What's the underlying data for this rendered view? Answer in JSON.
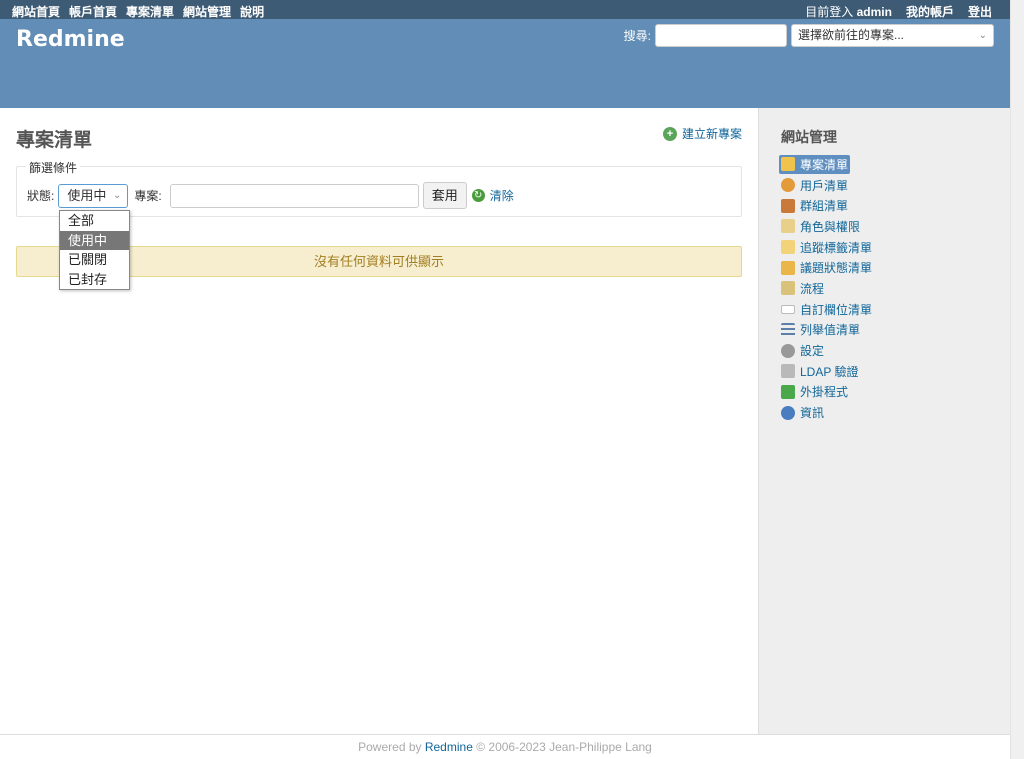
{
  "top_menu": {
    "left_items": [
      "網站首頁",
      "帳戶首頁",
      "專案清單",
      "網站管理",
      "說明"
    ],
    "logged_as_prefix": "目前登入",
    "logged_as_user": "admin",
    "my_account": "我的帳戶",
    "logout": "登出"
  },
  "header": {
    "title": "Redmine",
    "search_label": "搜尋:",
    "search_value": "",
    "project_jump_placeholder": "選擇欲前往的專案..."
  },
  "content": {
    "title": "專案清單",
    "new_project_link": "建立新專案",
    "filters_legend": "篩選條件",
    "status_label": "狀態:",
    "status_selected": "使用中",
    "project_label": "專案:",
    "project_value": "",
    "apply_button": "套用",
    "clear_link": "清除",
    "nodata_message": "沒有任何資料可供顯示"
  },
  "status_dropdown": {
    "options": [
      "全部",
      "使用中",
      "已關閉",
      "已封存"
    ],
    "selected_index": 1
  },
  "sidebar": {
    "title": "網站管理",
    "items": [
      {
        "label": "專案清單",
        "icon": "projects-icon",
        "selected": true
      },
      {
        "label": "用戶清單",
        "icon": "user-icon",
        "selected": false
      },
      {
        "label": "群組清單",
        "icon": "group-icon",
        "selected": false
      },
      {
        "label": "角色與權限",
        "icon": "roles-icon",
        "selected": false
      },
      {
        "label": "追蹤標籤清單",
        "icon": "trackers-icon",
        "selected": false
      },
      {
        "label": "議題狀態清單",
        "icon": "issue-status-icon",
        "selected": false
      },
      {
        "label": "流程",
        "icon": "workflow-icon",
        "selected": false
      },
      {
        "label": "自訂欄位清單",
        "icon": "custom-fields-icon",
        "selected": false
      },
      {
        "label": "列舉值清單",
        "icon": "enumerations-icon",
        "selected": false
      },
      {
        "label": "設定",
        "icon": "settings-gear-icon",
        "selected": false
      },
      {
        "label": "LDAP 驗證",
        "icon": "ldap-icon",
        "selected": false
      },
      {
        "label": "外掛程式",
        "icon": "plugins-icon",
        "selected": false
      },
      {
        "label": "資訊",
        "icon": "info-icon",
        "selected": false
      }
    ]
  },
  "footer": {
    "powered_by": "Powered by",
    "brand": "Redmine",
    "copyright": "© 2006-2023 Jean-Philippe Lang"
  },
  "colors": {
    "top_menu_bg": "#3e5b76",
    "header_bg": "#628db6",
    "link": "#116699",
    "nodata_bg": "#f6eecf",
    "sidebar_bg": "#eeeeee"
  }
}
